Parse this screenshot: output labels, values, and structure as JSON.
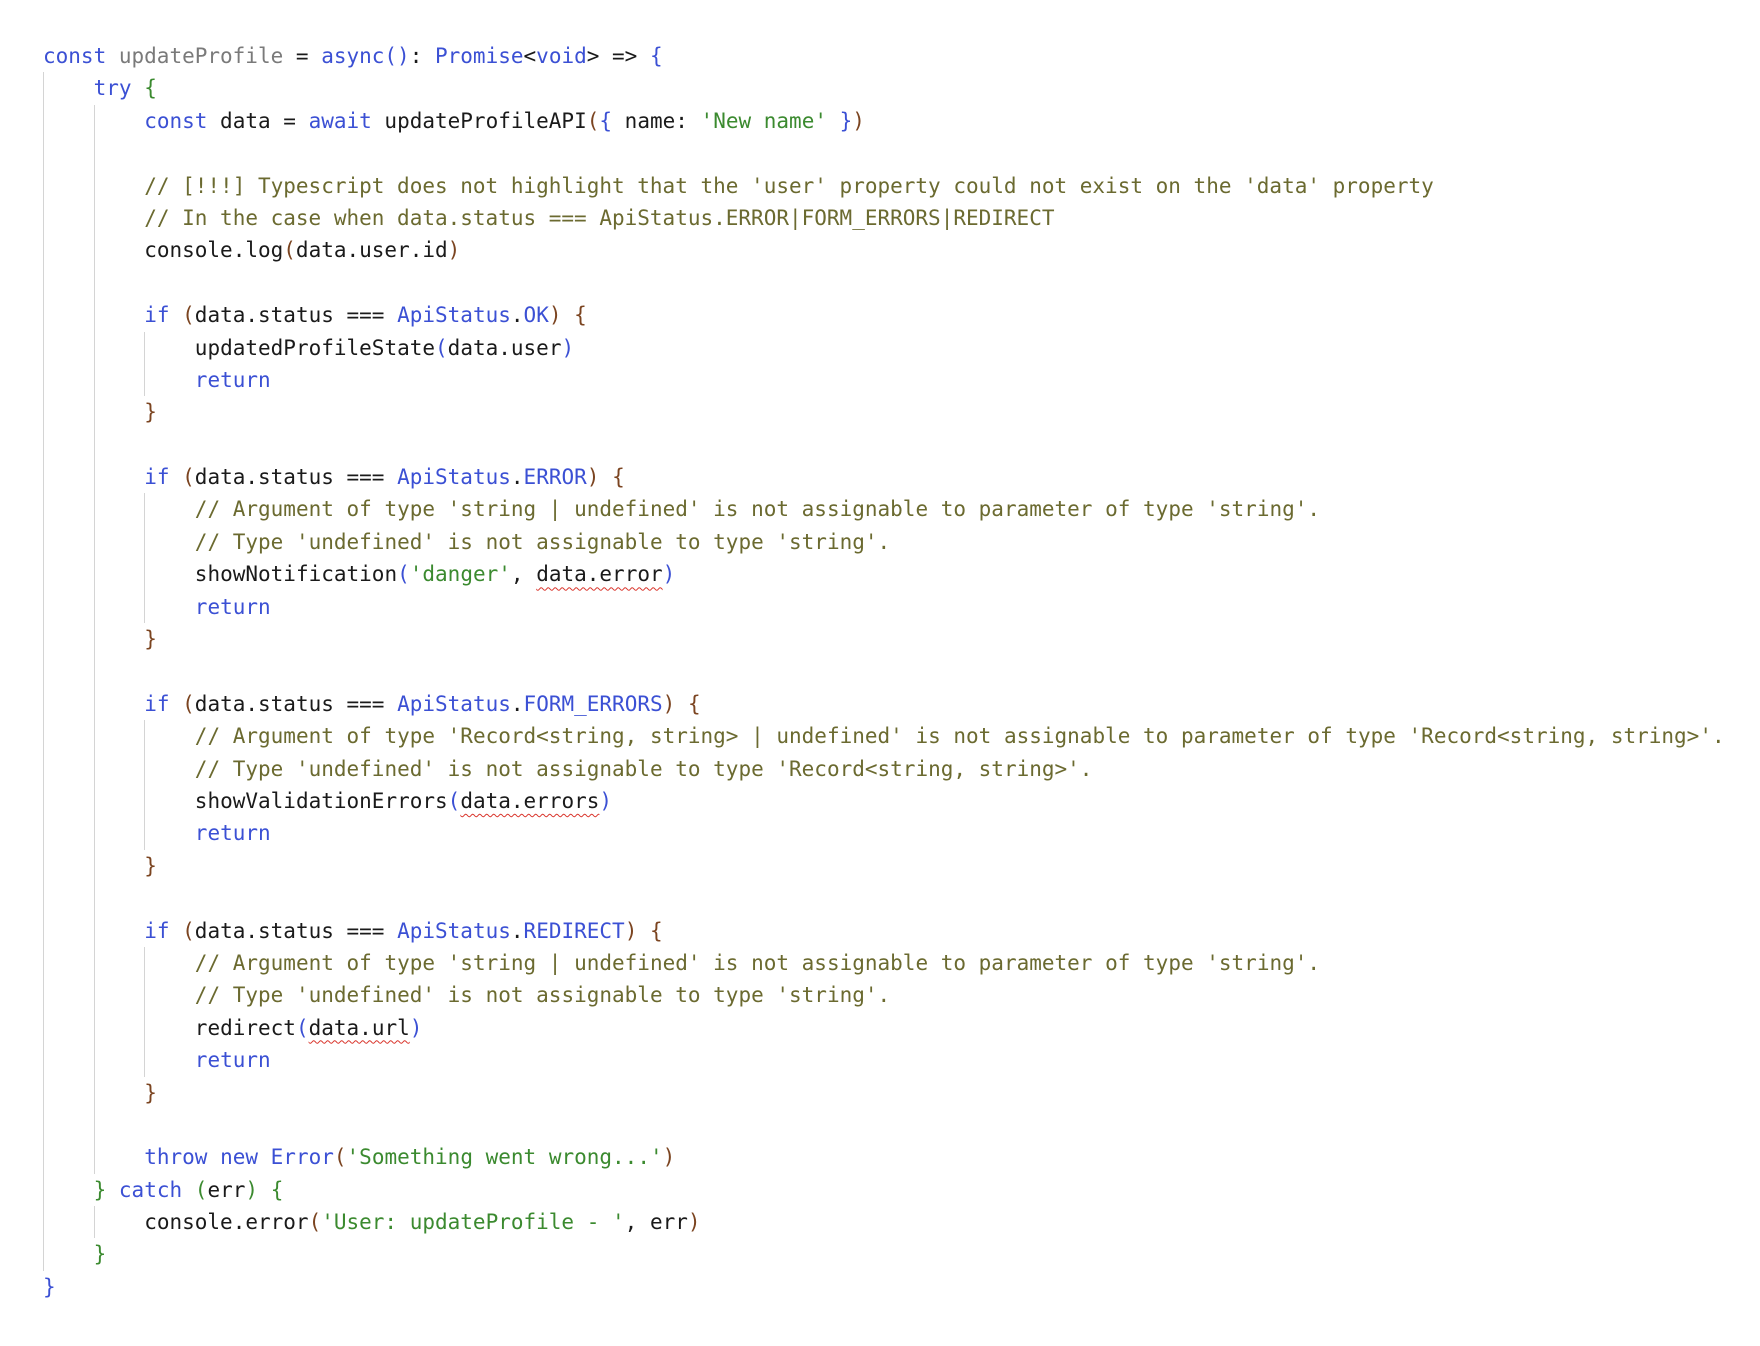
{
  "editor": {
    "language": "typescript",
    "lines": [
      {
        "indent": 0,
        "tokens": [
          [
            "kw",
            "const"
          ],
          [
            "plain",
            " "
          ],
          [
            "dim",
            "updateProfile"
          ],
          [
            "plain",
            " = "
          ],
          [
            "kw",
            "async"
          ],
          [
            "b1",
            "()"
          ],
          [
            "plain",
            ": "
          ],
          [
            "type",
            "Promise"
          ],
          [
            "plain",
            "<"
          ],
          [
            "type",
            "void"
          ],
          [
            "plain",
            "> => "
          ],
          [
            "b1",
            "{"
          ]
        ]
      },
      {
        "indent": 1,
        "tokens": [
          [
            "kw",
            "try"
          ],
          [
            "plain",
            " "
          ],
          [
            "b2",
            "{"
          ]
        ]
      },
      {
        "indent": 2,
        "tokens": [
          [
            "kw",
            "const"
          ],
          [
            "plain",
            " data = "
          ],
          [
            "kw",
            "await"
          ],
          [
            "plain",
            " updateProfileAPI"
          ],
          [
            "b3",
            "("
          ],
          [
            "b1",
            "{"
          ],
          [
            "plain",
            " name: "
          ],
          [
            "str",
            "'New name'"
          ],
          [
            "plain",
            " "
          ],
          [
            "b1",
            "}"
          ],
          [
            "b3",
            ")"
          ]
        ]
      },
      {
        "indent": 2,
        "tokens": []
      },
      {
        "indent": 2,
        "tokens": [
          [
            "cm",
            "// [!!!] Typescript does not highlight that the 'user' property could not exist on the 'data' property"
          ]
        ]
      },
      {
        "indent": 2,
        "tokens": [
          [
            "cm",
            "// In the case when data.status === ApiStatus.ERROR|FORM_ERRORS|REDIRECT"
          ]
        ]
      },
      {
        "indent": 2,
        "tokens": [
          [
            "plain",
            "console.log"
          ],
          [
            "b3",
            "("
          ],
          [
            "plain",
            "data.user.id"
          ],
          [
            "b3",
            ")"
          ]
        ]
      },
      {
        "indent": 2,
        "tokens": []
      },
      {
        "indent": 2,
        "tokens": [
          [
            "kw",
            "if"
          ],
          [
            "plain",
            " "
          ],
          [
            "b3",
            "("
          ],
          [
            "plain",
            "data.status === "
          ],
          [
            "type",
            "ApiStatus"
          ],
          [
            "plain",
            "."
          ],
          [
            "type",
            "OK"
          ],
          [
            "b3",
            ")"
          ],
          [
            "plain",
            " "
          ],
          [
            "b3",
            "{"
          ]
        ]
      },
      {
        "indent": 3,
        "tokens": [
          [
            "plain",
            "updatedProfileState"
          ],
          [
            "b1",
            "("
          ],
          [
            "plain",
            "data.user"
          ],
          [
            "b1",
            ")"
          ]
        ]
      },
      {
        "indent": 3,
        "tokens": [
          [
            "kw",
            "return"
          ]
        ]
      },
      {
        "indent": 2,
        "tokens": [
          [
            "b3",
            "}"
          ]
        ]
      },
      {
        "indent": 2,
        "tokens": []
      },
      {
        "indent": 2,
        "tokens": [
          [
            "kw",
            "if"
          ],
          [
            "plain",
            " "
          ],
          [
            "b3",
            "("
          ],
          [
            "plain",
            "data.status === "
          ],
          [
            "type",
            "ApiStatus"
          ],
          [
            "plain",
            "."
          ],
          [
            "type",
            "ERROR"
          ],
          [
            "b3",
            ")"
          ],
          [
            "plain",
            " "
          ],
          [
            "b3",
            "{"
          ]
        ]
      },
      {
        "indent": 3,
        "tokens": [
          [
            "cm",
            "// Argument of type 'string | undefined' is not assignable to parameter of type 'string'."
          ]
        ]
      },
      {
        "indent": 3,
        "tokens": [
          [
            "cm",
            "// Type 'undefined' is not assignable to type 'string'."
          ]
        ]
      },
      {
        "indent": 3,
        "tokens": [
          [
            "plain",
            "showNotification"
          ],
          [
            "b1",
            "("
          ],
          [
            "str",
            "'danger'"
          ],
          [
            "plain",
            ", "
          ],
          [
            "err",
            "data.error"
          ],
          [
            "b1",
            ")"
          ]
        ]
      },
      {
        "indent": 3,
        "tokens": [
          [
            "kw",
            "return"
          ]
        ]
      },
      {
        "indent": 2,
        "tokens": [
          [
            "b3",
            "}"
          ]
        ]
      },
      {
        "indent": 2,
        "tokens": []
      },
      {
        "indent": 2,
        "tokens": [
          [
            "kw",
            "if"
          ],
          [
            "plain",
            " "
          ],
          [
            "b3",
            "("
          ],
          [
            "plain",
            "data.status === "
          ],
          [
            "type",
            "ApiStatus"
          ],
          [
            "plain",
            "."
          ],
          [
            "type",
            "FORM_ERRORS"
          ],
          [
            "b3",
            ")"
          ],
          [
            "plain",
            " "
          ],
          [
            "b3",
            "{"
          ]
        ]
      },
      {
        "indent": 3,
        "tokens": [
          [
            "cm",
            "// Argument of type 'Record<string, string> | undefined' is not assignable to parameter of type 'Record<string, string>'."
          ]
        ]
      },
      {
        "indent": 3,
        "tokens": [
          [
            "cm",
            "// Type 'undefined' is not assignable to type 'Record<string, string>'."
          ]
        ]
      },
      {
        "indent": 3,
        "tokens": [
          [
            "plain",
            "showValidationErrors"
          ],
          [
            "b1",
            "("
          ],
          [
            "err",
            "data.errors"
          ],
          [
            "b1",
            ")"
          ]
        ]
      },
      {
        "indent": 3,
        "tokens": [
          [
            "kw",
            "return"
          ]
        ]
      },
      {
        "indent": 2,
        "tokens": [
          [
            "b3",
            "}"
          ]
        ]
      },
      {
        "indent": 2,
        "tokens": []
      },
      {
        "indent": 2,
        "tokens": [
          [
            "kw",
            "if"
          ],
          [
            "plain",
            " "
          ],
          [
            "b3",
            "("
          ],
          [
            "plain",
            "data.status === "
          ],
          [
            "type",
            "ApiStatus"
          ],
          [
            "plain",
            "."
          ],
          [
            "type",
            "REDIRECT"
          ],
          [
            "b3",
            ")"
          ],
          [
            "plain",
            " "
          ],
          [
            "b3",
            "{"
          ]
        ]
      },
      {
        "indent": 3,
        "tokens": [
          [
            "cm",
            "// Argument of type 'string | undefined' is not assignable to parameter of type 'string'."
          ]
        ]
      },
      {
        "indent": 3,
        "tokens": [
          [
            "cm",
            "// Type 'undefined' is not assignable to type 'string'."
          ]
        ]
      },
      {
        "indent": 3,
        "tokens": [
          [
            "plain",
            "redirect"
          ],
          [
            "b1",
            "("
          ],
          [
            "err",
            "data.url"
          ],
          [
            "b1",
            ")"
          ]
        ]
      },
      {
        "indent": 3,
        "tokens": [
          [
            "kw",
            "return"
          ]
        ]
      },
      {
        "indent": 2,
        "tokens": [
          [
            "b3",
            "}"
          ]
        ]
      },
      {
        "indent": 2,
        "tokens": []
      },
      {
        "indent": 2,
        "tokens": [
          [
            "kw",
            "throw"
          ],
          [
            "plain",
            " "
          ],
          [
            "kw",
            "new"
          ],
          [
            "plain",
            " "
          ],
          [
            "type",
            "Error"
          ],
          [
            "b3",
            "("
          ],
          [
            "str",
            "'Something went wrong...'"
          ],
          [
            "b3",
            ")"
          ]
        ]
      },
      {
        "indent": 1,
        "tokens": [
          [
            "b2",
            "}"
          ],
          [
            "plain",
            " "
          ],
          [
            "kw",
            "catch"
          ],
          [
            "plain",
            " "
          ],
          [
            "b2",
            "("
          ],
          [
            "plain",
            "err"
          ],
          [
            "b2",
            ")"
          ],
          [
            "plain",
            " "
          ],
          [
            "b2",
            "{"
          ]
        ]
      },
      {
        "indent": 2,
        "tokens": [
          [
            "plain",
            "console.error"
          ],
          [
            "b3",
            "("
          ],
          [
            "str",
            "'User: updateProfile - '"
          ],
          [
            "plain",
            ", err"
          ],
          [
            "b3",
            ")"
          ]
        ]
      },
      {
        "indent": 1,
        "tokens": [
          [
            "b2",
            "}"
          ]
        ]
      },
      {
        "indent": 0,
        "tokens": [
          [
            "b1",
            "}"
          ]
        ]
      }
    ],
    "guides": [
      {
        "level": 0,
        "from": 1,
        "to": 37
      },
      {
        "level": 1,
        "from": 2,
        "to": 34
      },
      {
        "level": 2,
        "from": 9,
        "to": 10
      },
      {
        "level": 2,
        "from": 14,
        "to": 17
      },
      {
        "level": 2,
        "from": 21,
        "to": 24
      },
      {
        "level": 2,
        "from": 28,
        "to": 31
      },
      {
        "level": 1,
        "from": 36,
        "to": 36
      }
    ],
    "token_names": {
      "kw": "keyword-token",
      "type": "type-token",
      "dim": "identifier-token",
      "str": "string-token",
      "cm": "comment-token",
      "plain": "code-token",
      "b1": "bracket-token",
      "b2": "bracket-token",
      "b3": "bracket-token",
      "err": "error-squiggle-token"
    }
  }
}
